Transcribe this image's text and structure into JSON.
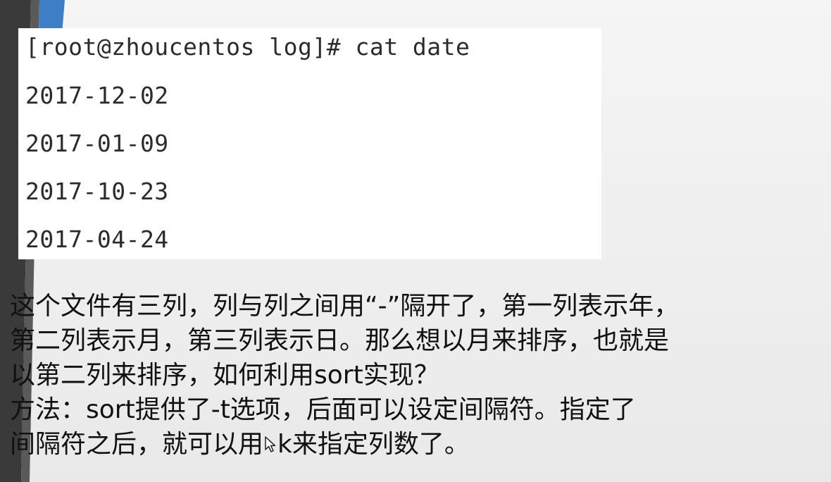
{
  "terminal": {
    "lines": [
      "[root@zhoucentos log]# cat date",
      "2017-12-02",
      "2017-01-09",
      "2017-10-23",
      "2017-04-24"
    ]
  },
  "explanation": {
    "line1": "这个文件有三列，列与列之间用“-”隔开了，第一列表示年，",
    "line2": "第二列表示月，第三列表示日。那么想以月来排序，也就是",
    "line3": "以第二列来排序，如何利用sort实现？",
    "line4": "方法：sort提供了-t选项，后面可以设定间隔符。指定了",
    "line5_before_cursor": "间隔符之后，就可以用",
    "line5_after_cursor": "k来指定列数了。"
  },
  "colors": {
    "accent_blue": "#3d7ec4",
    "accent_dark": "#3a3a3a",
    "terminal_bg": "#ffffff",
    "slide_bg": "#efefef"
  },
  "icons": {
    "pointer": "mouse-pointer-icon"
  }
}
